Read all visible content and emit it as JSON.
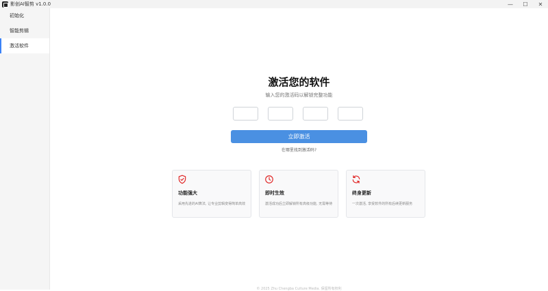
{
  "window": {
    "title": "影创AI智剪 v1.0.0",
    "minimize_glyph": "—",
    "maximize_glyph": "☐",
    "close_glyph": "✕"
  },
  "sidebar": {
    "items": [
      {
        "label": "初始化",
        "active": false
      },
      {
        "label": "智能剪辑",
        "active": false
      },
      {
        "label": "激活软件",
        "active": true
      }
    ]
  },
  "main": {
    "title": "激活您的软件",
    "subtitle": "输入您的激活码以解锁完整功能",
    "code_inputs": [
      "",
      "",
      "",
      ""
    ],
    "activate_label": "立即激活",
    "help_link": "在哪里找到激活码?",
    "cards": [
      {
        "icon": "shield-check-icon",
        "title": "功能强大",
        "desc": "采用先进的AI算法, 让专业剪辑变得简单高效"
      },
      {
        "icon": "clock-icon",
        "title": "即时生效",
        "desc": "激活成功后立即解锁所有高级功能, 无需等待"
      },
      {
        "icon": "refresh-icon",
        "title": "终身更新",
        "desc": "一次激活, 享受软件的所有后续更新服务"
      }
    ],
    "footer": "© 2025 Zhu Chengba Culture Media. 保留所有权利"
  },
  "colors": {
    "accent": "#4a90e2",
    "icon_red": "#e02424",
    "sidebar_bg": "#f5f5f5"
  }
}
